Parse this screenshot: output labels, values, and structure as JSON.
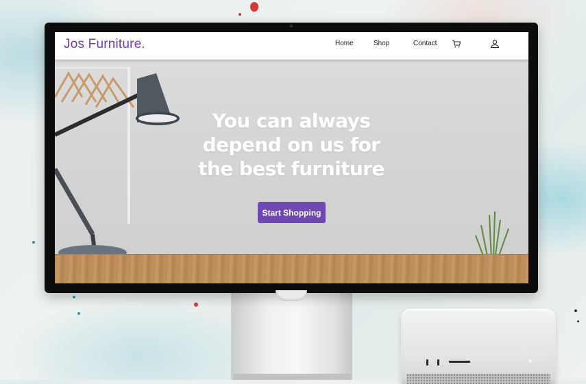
{
  "nav": {
    "brand": "Jos Furniture.",
    "links": [
      "Home",
      "Shop",
      "Contact"
    ],
    "cart_icon": "cart-icon",
    "user_icon": "user-icon"
  },
  "hero": {
    "title": "You can always depend on us for the best furniture",
    "cta_label": "Start Shopping"
  },
  "colors": {
    "brand": "#6a3fb0",
    "cta_bg": "#7048b3"
  }
}
